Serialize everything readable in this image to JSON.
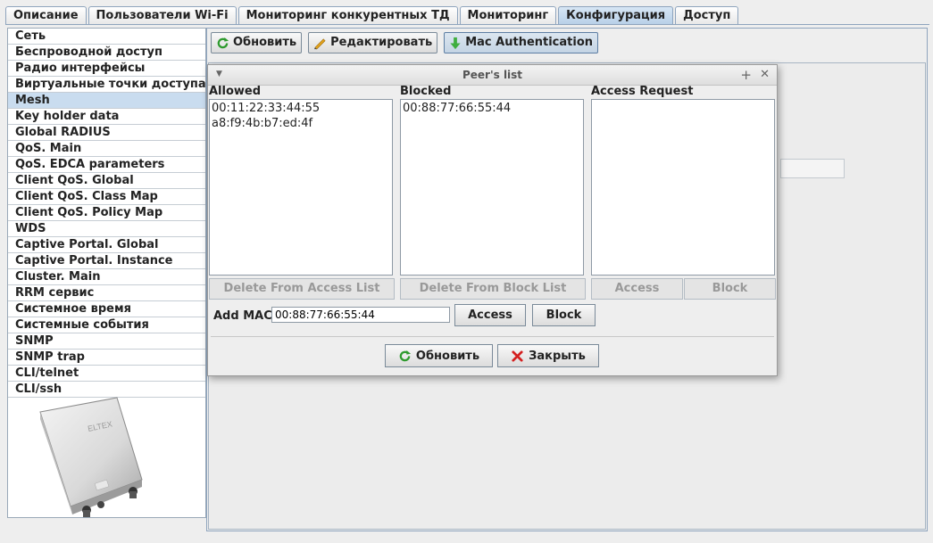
{
  "tabs": [
    {
      "label": "Описание"
    },
    {
      "label": "Пользователи Wi-Fi"
    },
    {
      "label": "Мониторинг конкурентных ТД"
    },
    {
      "label": "Мониторинг"
    },
    {
      "label": "Конфигурация",
      "active": true
    },
    {
      "label": "Доступ"
    }
  ],
  "sidebar": {
    "items": [
      {
        "label": "Сеть"
      },
      {
        "label": "Беспроводной доступ"
      },
      {
        "label": "Радио интерфейсы"
      },
      {
        "label": "Виртуальные точки доступа"
      },
      {
        "label": "Mesh",
        "selected": true
      },
      {
        "label": "Key holder data"
      },
      {
        "label": "Global RADIUS"
      },
      {
        "label": "QoS. Main"
      },
      {
        "label": "QoS. EDCA parameters"
      },
      {
        "label": "Client QoS. Global"
      },
      {
        "label": "Client QoS. Class Map"
      },
      {
        "label": "Client QoS. Policy Map"
      },
      {
        "label": "WDS"
      },
      {
        "label": "Captive Portal. Global"
      },
      {
        "label": "Captive Portal. Instance"
      },
      {
        "label": "Cluster. Main"
      },
      {
        "label": "RRM сервис"
      },
      {
        "label": "Системное время"
      },
      {
        "label": "Системные события"
      },
      {
        "label": "SNMP"
      },
      {
        "label": "SNMP trap"
      },
      {
        "label": "CLI/telnet"
      },
      {
        "label": "CLI/ssh"
      }
    ],
    "device_logo_text": "ELTEX"
  },
  "toolbar": {
    "refresh_label": "Обновить",
    "edit_label": "Редактировать",
    "mac_auth_label": "Mac Authentication"
  },
  "dialog": {
    "title": "Peer's list",
    "allowed": {
      "label": "Allowed",
      "items": [
        "00:11:22:33:44:55",
        "a8:f9:4b:b7:ed:4f"
      ],
      "delete_label": "Delete From Access List"
    },
    "blocked": {
      "label": "Blocked",
      "items": [
        "00:88:77:66:55:44"
      ],
      "delete_label": "Delete From Block List"
    },
    "access_request": {
      "label": "Access Request",
      "items": [],
      "access_label": "Access",
      "block_label": "Block"
    },
    "add_mac": {
      "label": "Add MAC",
      "value": "00:88:77:66:55:44",
      "access_label": "Access",
      "block_label": "Block"
    },
    "refresh_label": "Обновить",
    "close_label": "Закрыть"
  },
  "colors": {
    "selected_bg": "#c9dcef",
    "active_tab": "#b8d0e8",
    "disabled_text": "#999999"
  }
}
